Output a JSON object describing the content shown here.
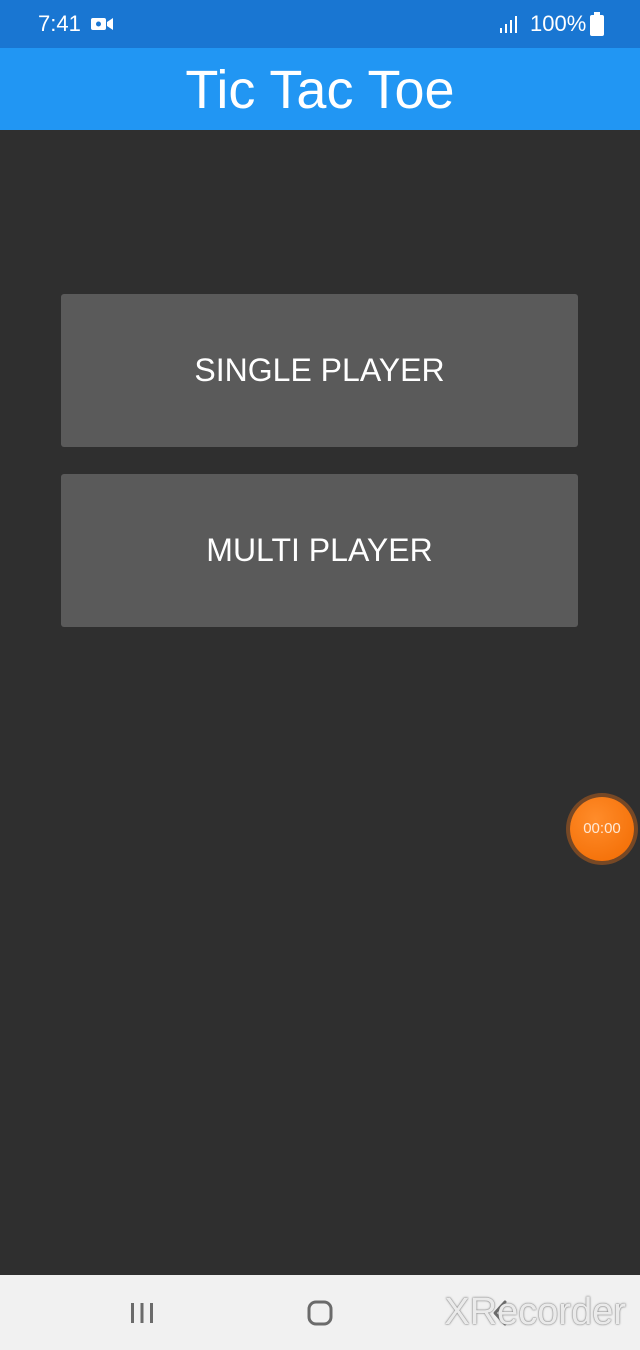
{
  "status_bar": {
    "time": "7:41",
    "battery_percent": "100%",
    "icons": [
      "video-camera-icon",
      "signal-icon",
      "battery-icon"
    ]
  },
  "app_bar": {
    "title": "Tic Tac Toe"
  },
  "menu": {
    "single_player_label": "SINGLE PLAYER",
    "multi_player_label": "MULTI PLAYER"
  },
  "recorder": {
    "timer": "00:00",
    "watermark": "XRecorder"
  },
  "nav_bar": {
    "icons": [
      "recents-icon",
      "home-icon",
      "back-icon"
    ]
  },
  "colors": {
    "status_bar": "#1976d2",
    "app_bar": "#2196f3",
    "background": "#2f2f2f",
    "button": "#5a5a5a",
    "recorder": "#f26a00",
    "nav_bar": "#f1f1f1"
  }
}
